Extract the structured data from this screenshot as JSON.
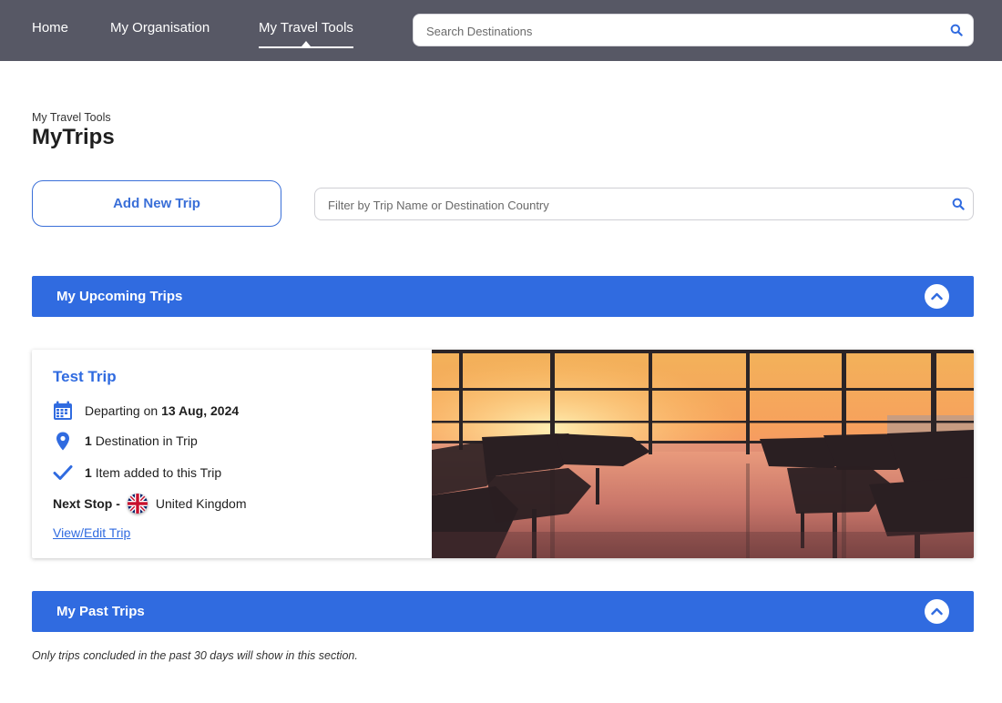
{
  "nav": {
    "items": [
      {
        "label": "Home"
      },
      {
        "label": "My Organisation"
      },
      {
        "label": "My Travel Tools"
      }
    ],
    "active": "My Travel Tools",
    "search_placeholder": "Search Destinations"
  },
  "header": {
    "breadcrumb": "My Travel Tools",
    "title": "MyTrips"
  },
  "actions": {
    "add_trip_label": "Add New Trip",
    "filter_placeholder": "Filter by Trip Name or Destination Country"
  },
  "upcoming": {
    "section_label": "My Upcoming Trips",
    "trips": [
      {
        "name": "Test Trip",
        "departing_prefix": "Departing on",
        "departing_date": "13 Aug, 2024",
        "destination_count": "1",
        "destination_text": "Destination in Trip",
        "item_count": "1",
        "item_text": "Item added to this Trip",
        "next_stop_label": "Next Stop -",
        "next_stop_country": "United Kingdom",
        "link_label": "View/Edit Trip",
        "image_icon": "airport-lounge-sunset-photo"
      }
    ]
  },
  "past": {
    "section_label": "My Past Trips",
    "note": "Only trips concluded in the past 30 days will show in this section."
  },
  "colors": {
    "nav_bg": "#575865",
    "accent": "#306be0"
  },
  "icons": {
    "search": "search-icon",
    "calendar": "calendar-icon",
    "location": "location-pin-icon",
    "check": "checkmark-icon",
    "collapse": "chevron-up-icon",
    "flag": "uk-flag-icon"
  }
}
